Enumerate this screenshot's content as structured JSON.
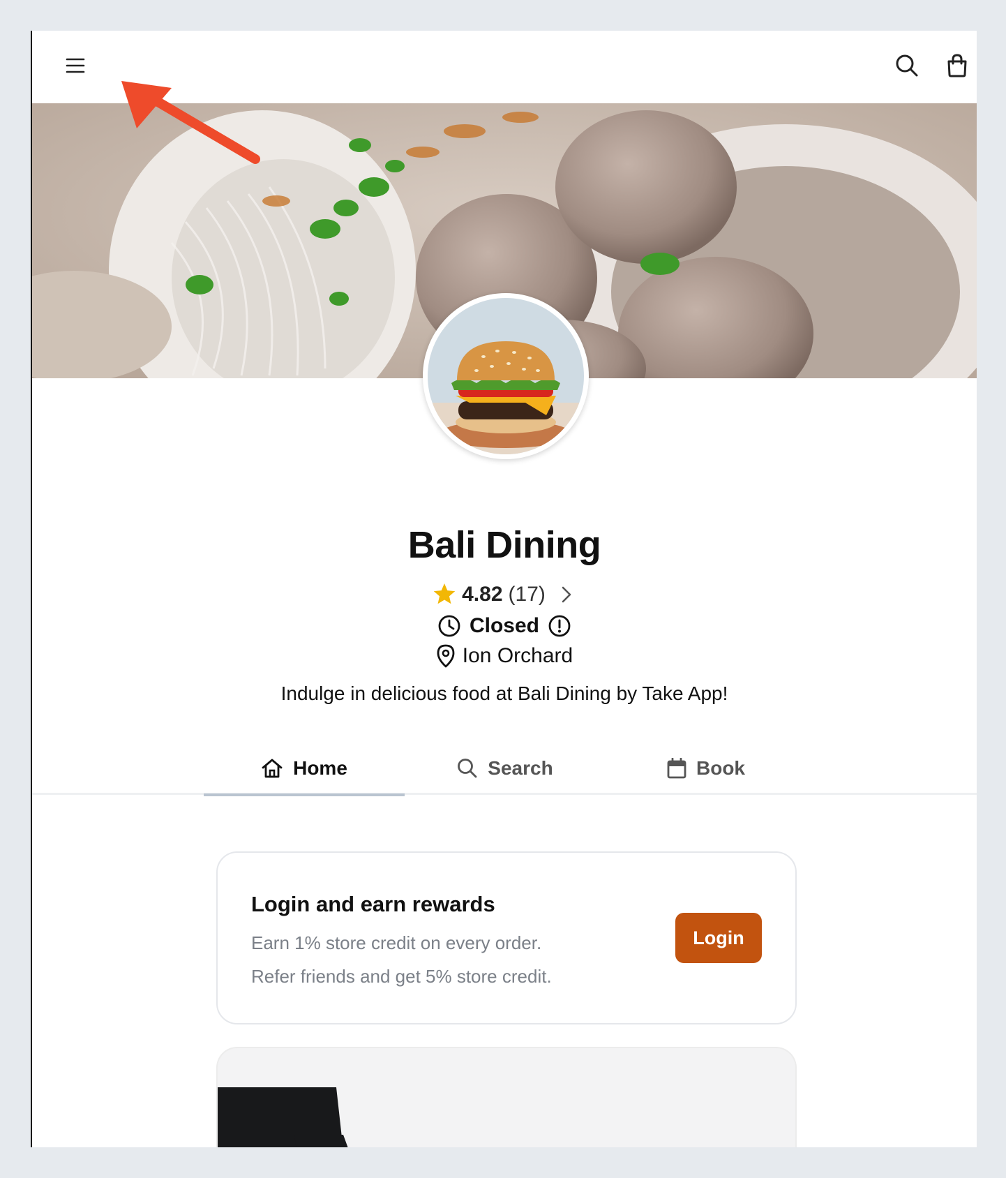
{
  "header": {
    "menu_icon": "hamburger-menu-icon",
    "search_icon": "search-icon",
    "cart_icon": "shopping-bag-icon"
  },
  "hero": {
    "image": "meatball-soup-banner"
  },
  "store": {
    "logo": "burger-logo",
    "name": "Bali Dining",
    "rating": "4.82",
    "rating_count": "(17)",
    "status": "Closed",
    "location": "Ion Orchard",
    "description": "Indulge in delicious food at Bali Dining by Take App!"
  },
  "tabs": [
    {
      "label": "Home",
      "icon": "home-icon",
      "active": true
    },
    {
      "label": "Search",
      "icon": "search-icon",
      "active": false
    },
    {
      "label": "Book",
      "icon": "calendar-icon",
      "active": false
    }
  ],
  "rewards": {
    "title": "Login and earn rewards",
    "line1": "Earn 1% store credit on every order.",
    "line2": "Refer friends and get 5% store credit.",
    "button": "Login"
  },
  "colors": {
    "accent": "#c2530f",
    "star": "#f2b705",
    "annotation_arrow": "#ee4b2b"
  }
}
